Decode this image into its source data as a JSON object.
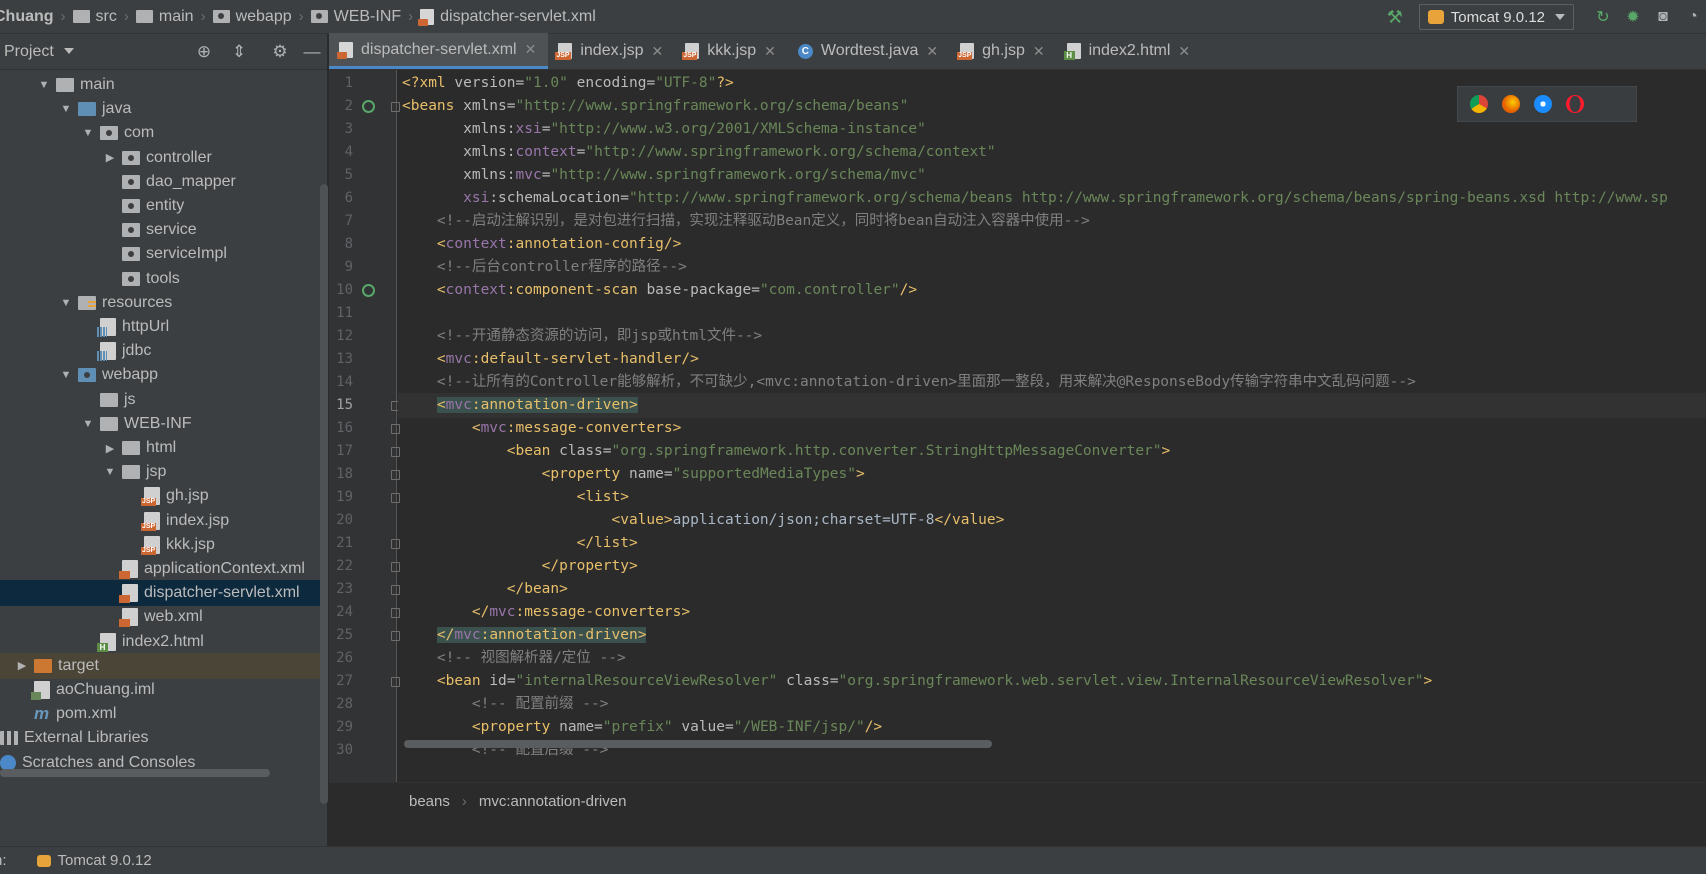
{
  "breadcrumbs": [
    "Chuang",
    "src",
    "main",
    "webapp",
    "WEB-INF",
    "dispatcher-servlet.xml"
  ],
  "run_config": {
    "label": "Tomcat 9.0.12"
  },
  "project_panel": {
    "title": "Project"
  },
  "tree": [
    {
      "label": "main",
      "depth": 1,
      "arrow": "down",
      "icon": "folder"
    },
    {
      "label": "java",
      "depth": 2,
      "arrow": "down",
      "icon": "src"
    },
    {
      "label": "com",
      "depth": 3,
      "arrow": "down",
      "icon": "pkg"
    },
    {
      "label": "controller",
      "depth": 4,
      "arrow": "right",
      "icon": "pkg"
    },
    {
      "label": "dao_mapper",
      "depth": 4,
      "arrow": "none",
      "icon": "pkg"
    },
    {
      "label": "entity",
      "depth": 4,
      "arrow": "none",
      "icon": "pkg"
    },
    {
      "label": "service",
      "depth": 4,
      "arrow": "none",
      "icon": "pkg"
    },
    {
      "label": "serviceImpl",
      "depth": 4,
      "arrow": "none",
      "icon": "pkg"
    },
    {
      "label": "tools",
      "depth": 4,
      "arrow": "none",
      "icon": "pkg"
    },
    {
      "label": "resources",
      "depth": 2,
      "arrow": "down",
      "icon": "res"
    },
    {
      "label": "httpUrl",
      "depth": 3,
      "arrow": "none",
      "icon": "prop"
    },
    {
      "label": "jdbc",
      "depth": 3,
      "arrow": "none",
      "icon": "prop"
    },
    {
      "label": "webapp",
      "depth": 2,
      "arrow": "down",
      "icon": "web"
    },
    {
      "label": "js",
      "depth": 3,
      "arrow": "none",
      "icon": "folder"
    },
    {
      "label": "WEB-INF",
      "depth": 3,
      "arrow": "down",
      "icon": "folder"
    },
    {
      "label": "html",
      "depth": 4,
      "arrow": "right",
      "icon": "folder"
    },
    {
      "label": "jsp",
      "depth": 4,
      "arrow": "down",
      "icon": "folder"
    },
    {
      "label": "gh.jsp",
      "depth": 5,
      "arrow": "none",
      "icon": "jsp"
    },
    {
      "label": "index.jsp",
      "depth": 5,
      "arrow": "none",
      "icon": "jsp"
    },
    {
      "label": "kkk.jsp",
      "depth": 5,
      "arrow": "none",
      "icon": "jsp"
    },
    {
      "label": "applicationContext.xml",
      "depth": 4,
      "arrow": "none",
      "icon": "xml"
    },
    {
      "label": "dispatcher-servlet.xml",
      "depth": 4,
      "arrow": "none",
      "icon": "xml",
      "selected": true
    },
    {
      "label": "web.xml",
      "depth": 4,
      "arrow": "none",
      "icon": "xml"
    },
    {
      "label": "index2.html",
      "depth": 3,
      "arrow": "none",
      "icon": "html"
    },
    {
      "label": "target",
      "depth": 0,
      "arrow": "right",
      "icon": "tgt",
      "excluded": true
    },
    {
      "label": "aoChuang.iml",
      "depth": 0,
      "arrow": "none",
      "icon": "iml"
    },
    {
      "label": "pom.xml",
      "depth": 0,
      "arrow": "none",
      "icon": "mvn"
    },
    {
      "label": "External Libraries",
      "depth": -1,
      "arrow": "none",
      "icon": "lib"
    },
    {
      "label": "Scratches and Consoles",
      "depth": -1,
      "arrow": "none",
      "icon": "scr"
    }
  ],
  "tabs": [
    {
      "label": "dispatcher-servlet.xml",
      "icon": "xml",
      "active": true
    },
    {
      "label": "index.jsp",
      "icon": "jsp"
    },
    {
      "label": "kkk.jsp",
      "icon": "jsp"
    },
    {
      "label": "Wordtest.java",
      "icon": "java"
    },
    {
      "label": "gh.jsp",
      "icon": "jsp"
    },
    {
      "label": "index2.html",
      "icon": "html"
    }
  ],
  "current_line": 15,
  "code": [
    [
      [
        "pi",
        "<?xml "
      ],
      [
        "a",
        "version="
      ],
      [
        "v",
        "\"1.0\""
      ],
      [
        "a",
        " encoding="
      ],
      [
        "v",
        "\"UTF-8\""
      ],
      [
        "pi",
        "?>"
      ]
    ],
    [
      [
        "t",
        "<beans "
      ],
      [
        "a",
        "xmlns="
      ],
      [
        "v",
        "\"http://www.springframework.org/schema/beans\""
      ]
    ],
    [
      [
        "a",
        "       xmlns:"
      ],
      [
        "ns",
        "xsi"
      ],
      [
        "a",
        "="
      ],
      [
        "v",
        "\"http://www.w3.org/2001/XMLSchema-instance\""
      ]
    ],
    [
      [
        "a",
        "       xmlns:"
      ],
      [
        "ns",
        "context"
      ],
      [
        "a",
        "="
      ],
      [
        "v",
        "\"http://www.springframework.org/schema/context\""
      ]
    ],
    [
      [
        "a",
        "       xmlns:"
      ],
      [
        "ns",
        "mvc"
      ],
      [
        "a",
        "="
      ],
      [
        "v",
        "\"http://www.springframework.org/schema/mvc\""
      ]
    ],
    [
      [
        "a",
        "       "
      ],
      [
        "ns",
        "xsi"
      ],
      [
        "a",
        ":schemaLocation="
      ],
      [
        "v",
        "\"http://www.springframework.org/schema/beans http://www.springframework.org/schema/beans/spring-beans.xsd http://www.sp"
      ]
    ],
    [
      [
        "c",
        "    <!--启动注解识别，是对包进行扫描，实现注释驱动Bean定义，同时将bean自动注入容器中使用-->"
      ]
    ],
    [
      [
        "t",
        "    <"
      ],
      [
        "ns",
        "context"
      ],
      [
        "t",
        ":annotation-config/>"
      ]
    ],
    [
      [
        "c",
        "    <!--后台controller程序的路径-->"
      ]
    ],
    [
      [
        "t",
        "    <"
      ],
      [
        "ns",
        "context"
      ],
      [
        "t",
        ":component-scan "
      ],
      [
        "a",
        "base-package="
      ],
      [
        "v",
        "\"com.controller\""
      ],
      [
        "t",
        "/>"
      ]
    ],
    [],
    [
      [
        "c",
        "    <!--开通静态资源的访问，即jsp或html文件-->"
      ]
    ],
    [
      [
        "t",
        "    <"
      ],
      [
        "ns",
        "mvc"
      ],
      [
        "t",
        ":default-servlet-handler/>"
      ]
    ],
    [
      [
        "c",
        "    <!--让所有的Controller能够解析，不可缺少,<mvc:annotation-driven>里面那一整段，用来解决@ResponseBody传输字符串中文乱码问题-->"
      ]
    ],
    [
      [
        "a",
        "    "
      ],
      [
        "hl",
        "<"
      ],
      [
        "hlns",
        "mvc"
      ],
      [
        "hl",
        ":annotation-driven>"
      ]
    ],
    [
      [
        "t",
        "        <"
      ],
      [
        "ns",
        "mvc"
      ],
      [
        "t",
        ":message-converters>"
      ]
    ],
    [
      [
        "t",
        "            <bean "
      ],
      [
        "a",
        "class="
      ],
      [
        "v",
        "\"org.springframework.http.converter.StringHttpMessageConverter\""
      ],
      [
        "t",
        ">"
      ]
    ],
    [
      [
        "t",
        "                <property "
      ],
      [
        "a",
        "name="
      ],
      [
        "v",
        "\"supportedMediaTypes\""
      ],
      [
        "t",
        ">"
      ]
    ],
    [
      [
        "t",
        "                    <list>"
      ]
    ],
    [
      [
        "t",
        "                        <value>"
      ],
      [
        "tx",
        "application/json;charset=UTF-8"
      ],
      [
        "t",
        "</value>"
      ]
    ],
    [
      [
        "t",
        "                    </list>"
      ]
    ],
    [
      [
        "t",
        "                </property>"
      ]
    ],
    [
      [
        "t",
        "            </bean>"
      ]
    ],
    [
      [
        "t",
        "        </"
      ],
      [
        "ns",
        "mvc"
      ],
      [
        "t",
        ":message-converters>"
      ]
    ],
    [
      [
        "a",
        "    "
      ],
      [
        "hl",
        "</"
      ],
      [
        "hlns",
        "mvc"
      ],
      [
        "hl",
        ":annotation-driven>"
      ]
    ],
    [
      [
        "c",
        "    <!-- 视图解析器/定位 -->"
      ]
    ],
    [
      [
        "t",
        "    <bean "
      ],
      [
        "a",
        "id="
      ],
      [
        "v",
        "\"internalResourceViewResolver\""
      ],
      [
        "a",
        " class="
      ],
      [
        "v",
        "\"org.springframework.web.servlet.view.InternalResourceViewResolver\""
      ],
      [
        "t",
        ">"
      ]
    ],
    [
      [
        "c",
        "        <!-- 配置前缀 -->"
      ]
    ],
    [
      [
        "t",
        "        <property "
      ],
      [
        "a",
        "name="
      ],
      [
        "v",
        "\"prefix\""
      ],
      [
        "a",
        " value="
      ],
      [
        "v",
        "\"/WEB-INF/jsp/\""
      ],
      [
        "t",
        "/>"
      ]
    ],
    [
      [
        "c",
        "        <!-- 配置后缀 -->"
      ]
    ]
  ],
  "editor_breadcrumb": [
    "beans",
    "mvc:annotation-driven"
  ],
  "bottom_bar": {
    "label": "n:",
    "run_label": "Tomcat 9.0.12"
  },
  "colors": {
    "accent": "#4a88c7",
    "selection": "#0d293e",
    "tag": "#e8bf6a",
    "string": "#6a8759",
    "comment": "#808080",
    "namespace": "#9876aa"
  }
}
